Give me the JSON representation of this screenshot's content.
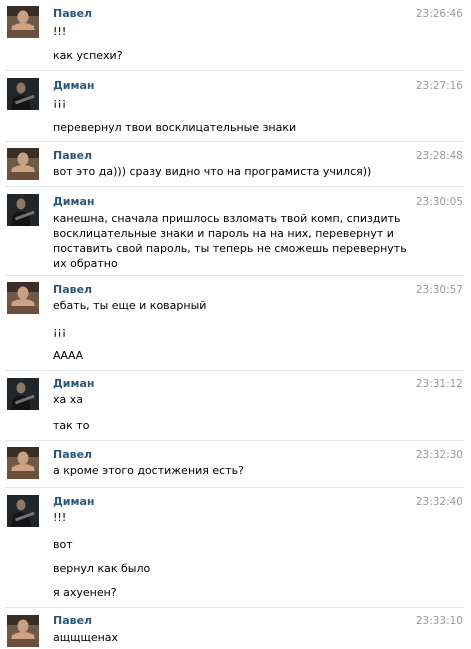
{
  "messages": [
    {
      "author": "Павел",
      "time": "23:26:46",
      "lines": [
        "!!!",
        "как успехи?"
      ]
    },
    {
      "author": "Диман",
      "time": "23:27:16",
      "lines": [
        "¡¡¡",
        "перевернул твои восклицательные знаки"
      ]
    },
    {
      "author": "Павел",
      "time": "23:28:48",
      "lines": [
        "вот это да))) сразу видно что на програмиста учился))"
      ]
    },
    {
      "author": "Диман",
      "time": "23:30:05",
      "lines": [
        "канешна, сначала пришлось взломать твой комп, спиздить восклицательные знаки и пароль на на них, перевернут и поставить свой пароль, ты теперь не сможешь перевернуть их обратно"
      ]
    },
    {
      "author": "Павел",
      "time": "23:30:57",
      "lines": [
        "ебать, ты еще и коварный",
        "¡¡¡",
        "АААА"
      ]
    },
    {
      "author": "Диман",
      "time": "23:31:12",
      "lines": [
        "ха ха",
        "так то"
      ]
    },
    {
      "author": "Павел",
      "time": "23:32:30",
      "lines": [
        "а кроме этого достижения есть?"
      ]
    },
    {
      "author": "Диман",
      "time": "23:32:40",
      "lines": [
        "!!!",
        "вот",
        "вернул как было",
        "я ахуенен?"
      ]
    },
    {
      "author": "Павел",
      "time": "23:33:10",
      "lines": [
        "ащщщенах"
      ]
    }
  ]
}
